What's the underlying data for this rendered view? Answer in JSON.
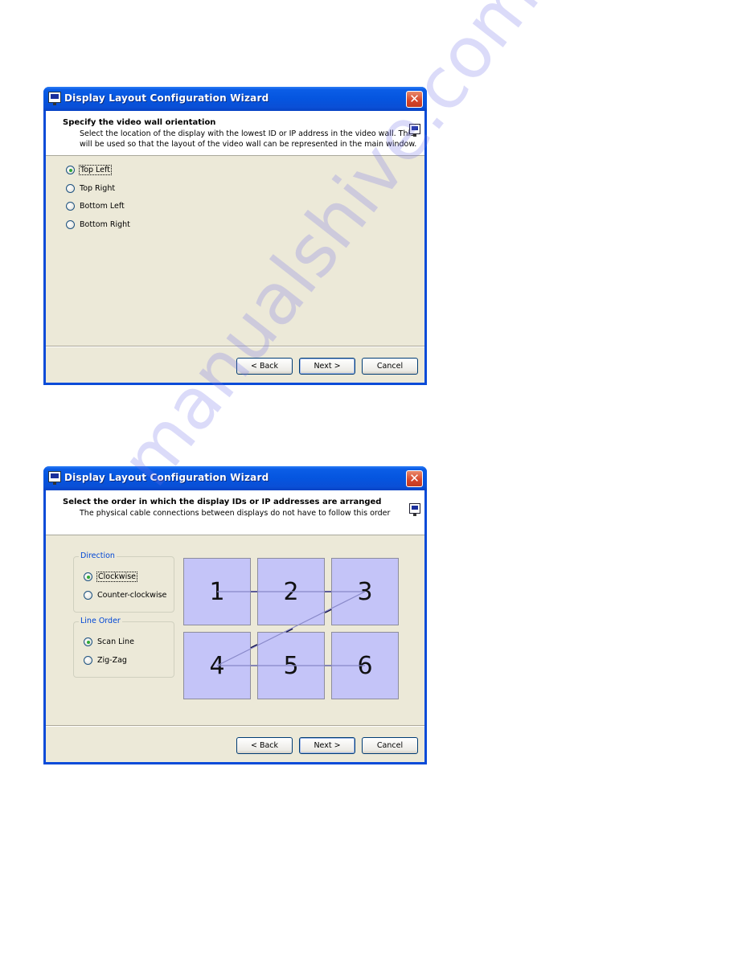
{
  "dialogs": [
    {
      "title": "Display Layout Configuration Wizard",
      "header": {
        "title": "Specify the video wall orientation",
        "description": "Select the location of the display with the lowest ID or IP address in the video wall. This will be used so that the layout of the video wall can be represented in the main window."
      },
      "orientation_options": [
        {
          "label": "Top Left",
          "checked": true
        },
        {
          "label": "Top Right",
          "checked": false
        },
        {
          "label": "Bottom Left",
          "checked": false
        },
        {
          "label": "Bottom Right",
          "checked": false
        }
      ],
      "buttons": {
        "back": "< Back",
        "next": "Next >",
        "cancel": "Cancel"
      }
    },
    {
      "title": "Display Layout Configuration Wizard",
      "header": {
        "title": "Select the order in which the display IDs or IP addresses are arranged",
        "description": "The physical cable connections between displays do not have to follow this order"
      },
      "direction": {
        "label": "Direction",
        "options": [
          {
            "label": "Clockwise",
            "checked": true
          },
          {
            "label": "Counter-clockwise",
            "checked": false
          }
        ]
      },
      "line_order": {
        "label": "Line Order",
        "options": [
          {
            "label": "Scan Line",
            "checked": true
          },
          {
            "label": "Zig-Zag",
            "checked": false
          }
        ]
      },
      "layout_preview": {
        "rows": 2,
        "columns": 3,
        "tiles": [
          "1",
          "2",
          "3",
          "4",
          "5",
          "6"
        ]
      },
      "buttons": {
        "back": "< Back",
        "next": "Next >",
        "cancel": "Cancel"
      }
    }
  ],
  "icons": {
    "app": "nec-monitor-icon",
    "close": "close-icon"
  },
  "watermark": "manualshive.com"
}
